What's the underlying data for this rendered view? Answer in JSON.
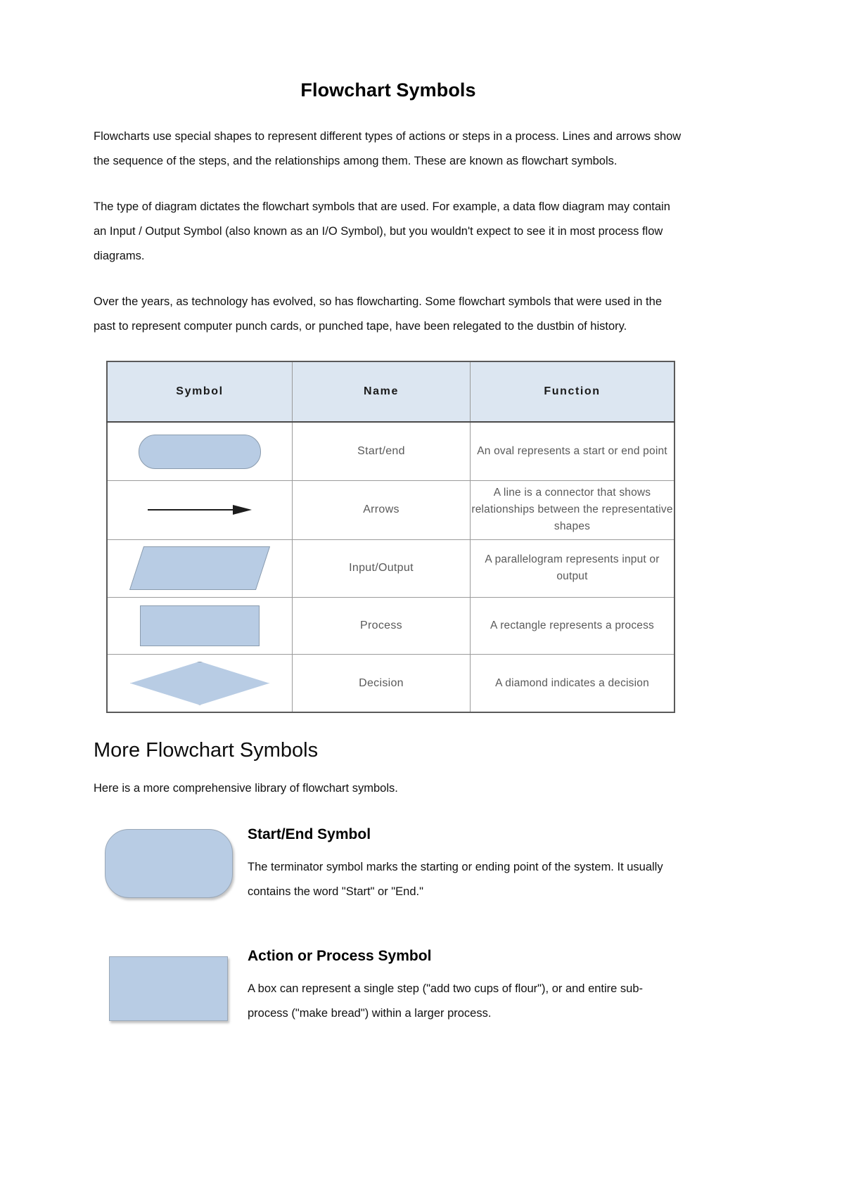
{
  "document": {
    "title": "Flowchart Symbols",
    "intro_paragraphs": [
      "Flowcharts use special shapes to represent different types of actions or steps in a process. Lines and arrows show the sequence of the steps, and the relationships among them. These are known as flowchart symbols.",
      "The type of diagram dictates the flowchart symbols that are used. For example, a data flow diagram may contain an Input / Output Symbol (also known as an I/O Symbol), but you wouldn't expect to see it in most process flow diagrams.",
      "Over the years, as technology has evolved, so has flowcharting. Some flowchart symbols that were used in the past to represent computer punch cards, or punched tape, have been relegated to the dustbin of history."
    ]
  },
  "symbol_table": {
    "headers": [
      "Symbol",
      "Name",
      "Function"
    ],
    "rows": [
      {
        "shape": "oval",
        "name": "Start/end",
        "function": "An oval represents a start or end point"
      },
      {
        "shape": "arrow",
        "name": "Arrows",
        "function": "A line is a connector that shows relationships between the representative shapes"
      },
      {
        "shape": "parallelogram",
        "name": "Input/Output",
        "function": "A parallelogram represents input or output"
      },
      {
        "shape": "rectangle",
        "name": "Process",
        "function": "A rectangle represents a process"
      },
      {
        "shape": "diamond",
        "name": "Decision",
        "function": "A diamond indicates a decision"
      }
    ]
  },
  "more_section": {
    "heading": "More Flowchart Symbols",
    "lead": "Here is a more comprehensive library of flowchart symbols.",
    "blocks": [
      {
        "shape": "stadium",
        "title": "Start/End Symbol",
        "description": "The terminator symbol marks the starting or ending point of the system. It usually contains the word \"Start\" or \"End.\""
      },
      {
        "shape": "rectangle",
        "title": "Action or Process Symbol",
        "description": "A box can represent a single step (\"add two cups of flour\"), or and entire sub-process (\"make bread\") within a larger process."
      }
    ]
  },
  "colors": {
    "shape_fill": "#b8cce4",
    "shape_border": "#8a9bad",
    "table_header_bg": "#dce6f1",
    "table_border": "#9a9a9a",
    "muted_text": "#595959"
  }
}
